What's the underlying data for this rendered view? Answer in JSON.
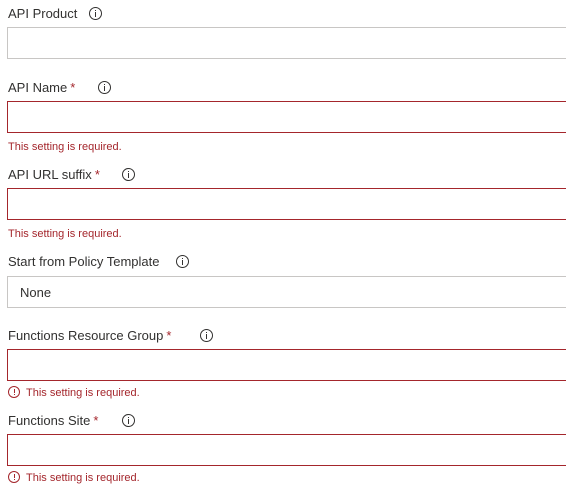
{
  "fields": {
    "api_product": {
      "label": "API Product",
      "value": ""
    },
    "api_name": {
      "label": "API Name",
      "required_marker": "*",
      "value": "",
      "error": "This setting is required."
    },
    "api_url_suffix": {
      "label": "API URL suffix",
      "required_marker": "*",
      "value": "",
      "error": "This setting is required."
    },
    "policy_template": {
      "label": "Start from Policy Template",
      "selected": "None"
    },
    "functions_resource_group": {
      "label": "Functions Resource Group",
      "required_marker": "*",
      "value": "",
      "error": "This setting is required."
    },
    "functions_site": {
      "label": "Functions Site",
      "required_marker": "*",
      "value": "",
      "error": "This setting is required."
    }
  },
  "colors": {
    "error": "#a4262c",
    "border": "#c8c6c4",
    "text": "#323130"
  },
  "icons": {
    "info": "info-circle-icon",
    "error": "error-circle-icon"
  }
}
